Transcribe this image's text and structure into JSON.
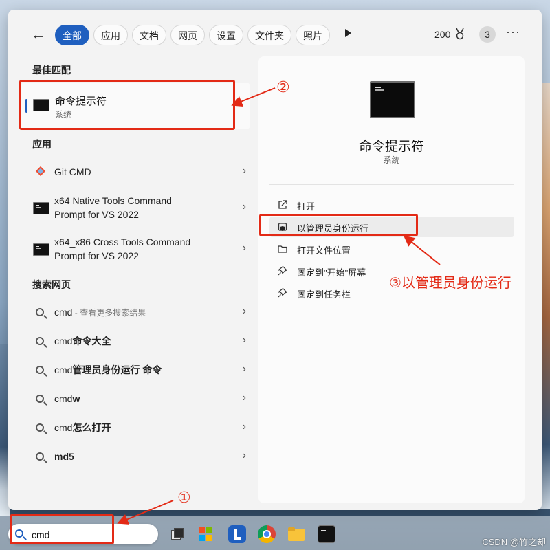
{
  "filters": {
    "back_icon": "back-arrow-icon",
    "tabs": [
      "全部",
      "应用",
      "文档",
      "网页",
      "设置",
      "文件夹",
      "照片"
    ],
    "points": "200",
    "profile_badge": "3",
    "more": "···"
  },
  "left": {
    "best_match_header": "最佳匹配",
    "best_match": {
      "title": "命令提示符",
      "subtitle": "系统"
    },
    "apps_header": "应用",
    "apps": [
      {
        "label": "Git CMD",
        "icon": "git-icon"
      },
      {
        "label_line1": "x64 Native Tools Command",
        "label_line2": "Prompt for VS 2022",
        "icon": "cmd-icon"
      },
      {
        "label_line1": "x64_x86 Cross Tools Command",
        "label_line2": "Prompt for VS 2022",
        "icon": "cmd-icon"
      }
    ],
    "web_header": "搜索网页",
    "web": [
      {
        "label": "cmd",
        "hint": " - 查看更多搜索结果"
      },
      {
        "prefix": "cmd",
        "bold": "命令大全"
      },
      {
        "prefix": "cmd",
        "bold": "管理员身份运行 命令"
      },
      {
        "prefix": "cmd",
        "bold": "w"
      },
      {
        "prefix": "cmd",
        "bold": "怎么打开"
      },
      {
        "prefix": "",
        "bold": "md5"
      }
    ]
  },
  "right": {
    "title": "命令提示符",
    "subtitle": "系统",
    "actions": [
      {
        "label": "打开",
        "icon": "open-external-icon"
      },
      {
        "label": "以管理员身份运行",
        "icon": "shield-admin-icon"
      },
      {
        "label": "打开文件位置",
        "icon": "folder-icon"
      },
      {
        "label": "固定到\"开始\"屏幕",
        "icon": "pin-icon"
      },
      {
        "label": "固定到任务栏",
        "icon": "pin-icon"
      }
    ]
  },
  "annotations": {
    "step1": "①",
    "step2": "②",
    "step3": "③以管理员身份运行",
    "color": "#e32a16"
  },
  "taskbar": {
    "search_value": "cmd",
    "apps": [
      "task-view-icon",
      "store-icon",
      "lenovo-icon",
      "chrome-icon",
      "file-explorer-icon",
      "terminal-icon"
    ]
  },
  "watermark": "CSDN @竹之却"
}
